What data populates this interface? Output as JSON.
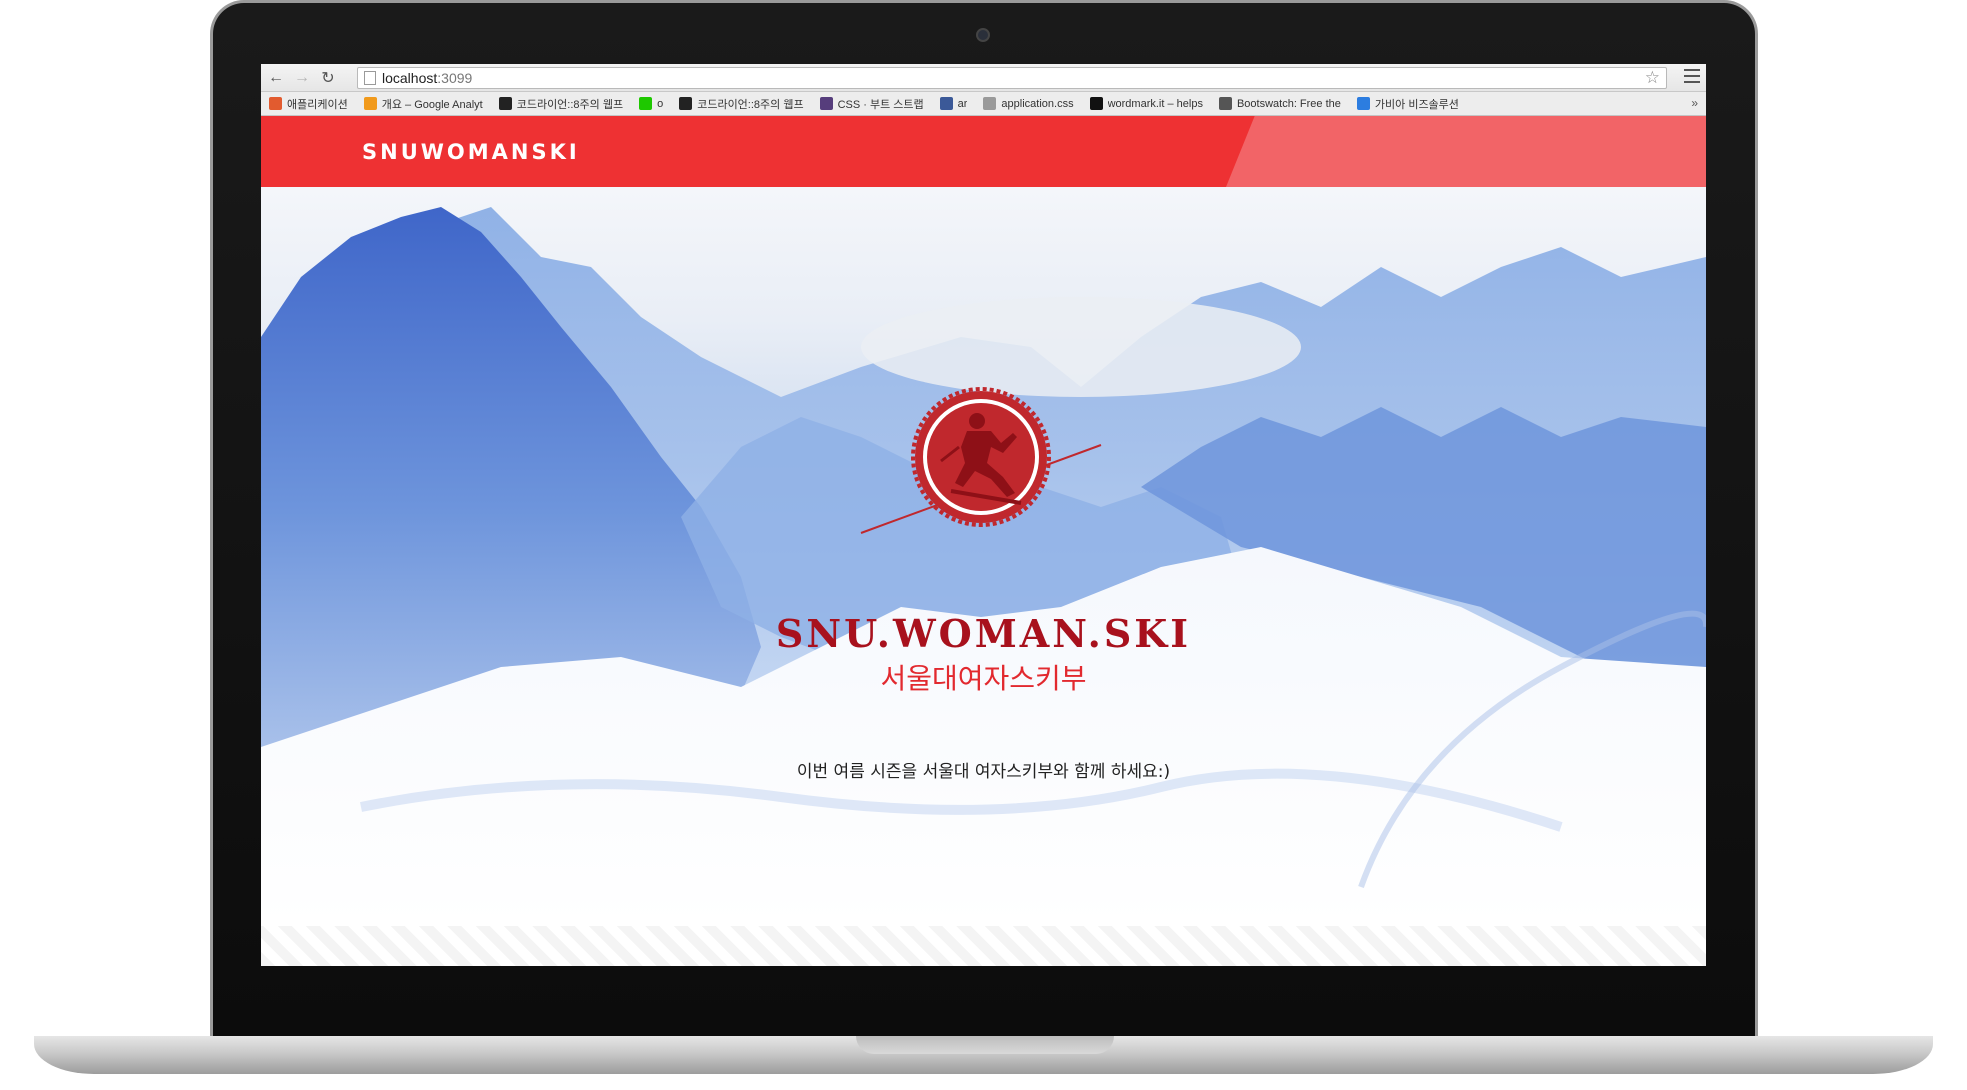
{
  "browser": {
    "url_host": "localhost",
    "url_port": ":3099",
    "back_icon": "back-arrow-icon",
    "forward_icon": "forward-arrow-icon",
    "reload_icon": "reload-icon",
    "bookmark_star_icon": "star-icon",
    "menu_icon": "hamburger-menu-icon",
    "bookmarks": [
      {
        "label": "애플리케이션",
        "icon": "apps-grid-icon",
        "color": "#e25b2f"
      },
      {
        "label": "개요 – Google Analyt",
        "icon": "analytics-icon",
        "color": "#f19a1c"
      },
      {
        "label": "코드라이언::8주의 웹프",
        "icon": "codelion-icon",
        "color": "#222222"
      },
      {
        "label": "o",
        "icon": "naver-icon",
        "color": "#1ec800"
      },
      {
        "label": "코드라이언::8주의 웹프",
        "icon": "codelion-icon",
        "color": "#222222"
      },
      {
        "label": "CSS · 부트 스트랩",
        "icon": "bootstrap-icon",
        "color": "#563d7c"
      },
      {
        "label": "ar",
        "icon": "facebook-icon",
        "color": "#3b5998"
      },
      {
        "label": "application.css",
        "icon": "file-icon",
        "color": "#9a9a9a"
      },
      {
        "label": "wordmark.it – helps",
        "icon": "wordmark-icon",
        "color": "#111111"
      },
      {
        "label": "Bootswatch: Free the",
        "icon": "bootswatch-icon",
        "color": "#555555"
      },
      {
        "label": "가비아 비즈솔루션",
        "icon": "gabia-icon",
        "color": "#2c7de0"
      }
    ],
    "bookmarks_more": "»"
  },
  "site": {
    "brand": "SNUWOMANSKI",
    "header_color": "#ee3133",
    "hero_title": "SNU.WOMAN.SKI",
    "hero_subtitle": "서울대여자스키부",
    "hero_tagline": "이번 여름 시즌을 서울대 여자스키부와 함께 하세요:)",
    "logo_icon": "skier-badge-icon"
  }
}
